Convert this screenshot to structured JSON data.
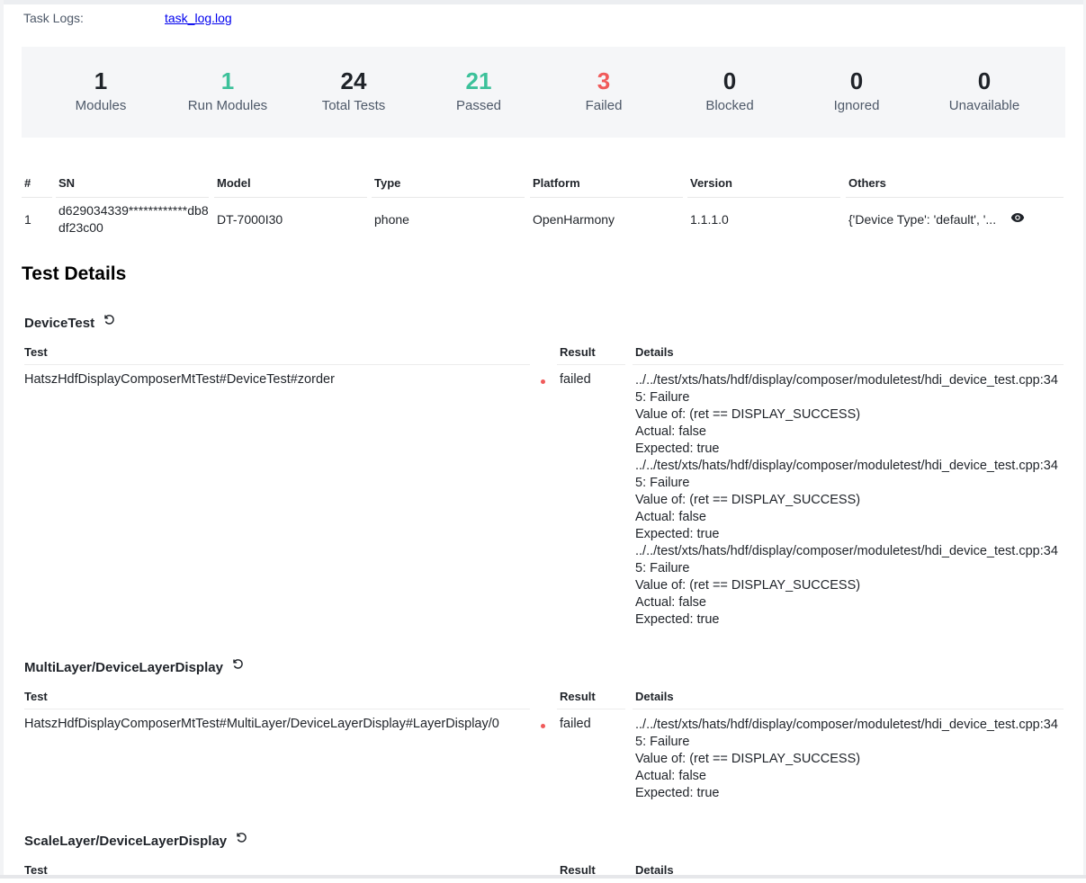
{
  "task_logs": {
    "label": "Task Logs:",
    "link": "task_log.log"
  },
  "stats": [
    {
      "value": "1",
      "label": "Modules",
      "color": "#1f2329"
    },
    {
      "value": "1",
      "label": "Run Modules",
      "color": "#3cc19a"
    },
    {
      "value": "24",
      "label": "Total Tests",
      "color": "#1f2329"
    },
    {
      "value": "21",
      "label": "Passed",
      "color": "#3cc19a"
    },
    {
      "value": "3",
      "label": "Failed",
      "color": "#f05a5a"
    },
    {
      "value": "0",
      "label": "Blocked",
      "color": "#1f2329"
    },
    {
      "value": "0",
      "label": "Ignored",
      "color": "#1f2329"
    },
    {
      "value": "0",
      "label": "Unavailable",
      "color": "#1f2329"
    }
  ],
  "devices": {
    "headers": [
      "#",
      "SN",
      "Model",
      "Type",
      "Platform",
      "Version",
      "Others"
    ],
    "rows": [
      {
        "index": "1",
        "sn": "d629034339************db8df23c00",
        "model": "DT-7000I30",
        "type": "phone",
        "platform": "OpenHarmony",
        "version": "1.1.1.0",
        "others": "{'Device Type': 'default', '...",
        "view_icon": "eye-icon"
      }
    ]
  },
  "test_details": {
    "title": "Test Details",
    "headers": {
      "test": "Test",
      "result": "Result",
      "details": "Details"
    },
    "reload_icon": "reload-icon",
    "groups": [
      {
        "name": "DeviceTest",
        "tests": [
          {
            "name": "HatszHdfDisplayComposerMtTest#DeviceTest#zorder",
            "result": "failed",
            "details": "../../test/xts/hats/hdf/display/composer/moduletest/hdi_device_test.cpp:345: Failure\nValue of: (ret == DISPLAY_SUCCESS)\nActual: false\nExpected: true\n../../test/xts/hats/hdf/display/composer/moduletest/hdi_device_test.cpp:345: Failure\nValue of: (ret == DISPLAY_SUCCESS)\nActual: false\nExpected: true\n../../test/xts/hats/hdf/display/composer/moduletest/hdi_device_test.cpp:345: Failure\nValue of: (ret == DISPLAY_SUCCESS)\nActual: false\nExpected: true"
          }
        ]
      },
      {
        "name": "MultiLayer/DeviceLayerDisplay",
        "tests": [
          {
            "name": "HatszHdfDisplayComposerMtTest#MultiLayer/DeviceLayerDisplay#LayerDisplay/0",
            "result": "failed",
            "details": "../../test/xts/hats/hdf/display/composer/moduletest/hdi_device_test.cpp:345: Failure\nValue of: (ret == DISPLAY_SUCCESS)\nActual: false\nExpected: true"
          }
        ]
      },
      {
        "name": "ScaleLayer/DeviceLayerDisplay",
        "tests": []
      }
    ]
  }
}
